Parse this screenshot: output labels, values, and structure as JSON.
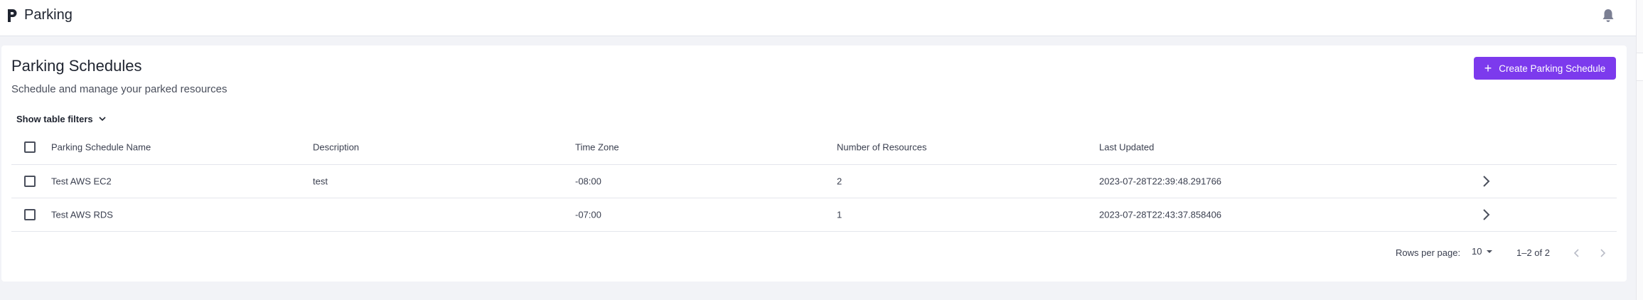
{
  "app": {
    "logo_letter": "P",
    "title": "Parking"
  },
  "header": {
    "notification_icon": "bell-icon"
  },
  "page": {
    "title": "Parking Schedules",
    "subtitle": "Schedule and manage your parked resources",
    "create_button_label": "Create Parking Schedule",
    "filters_toggle_label": "Show table filters"
  },
  "table": {
    "columns": [
      "Parking Schedule Name",
      "Description",
      "Time Zone",
      "Number of Resources",
      "Last Updated"
    ],
    "rows": [
      {
        "name": "Test AWS EC2",
        "description": "test",
        "time_zone": "-08:00",
        "resources": "2",
        "last_updated": "2023-07-28T22:39:48.291766"
      },
      {
        "name": "Test AWS RDS",
        "description": "",
        "time_zone": "-07:00",
        "resources": "1",
        "last_updated": "2023-07-28T22:43:37.858406"
      }
    ]
  },
  "pagination": {
    "rows_per_page_label": "Rows per page:",
    "rows_per_page_value": "10",
    "range_text": "1–2 of 2"
  },
  "colors": {
    "accent": "#7c3aed",
    "background": "#f2f3f7",
    "text": "#1f2430"
  }
}
